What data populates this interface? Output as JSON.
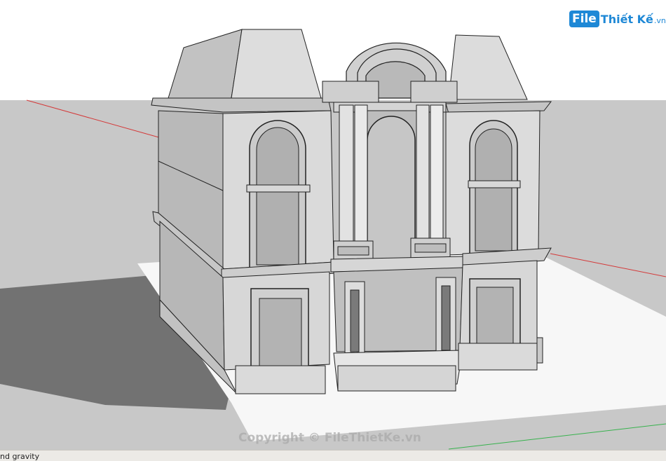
{
  "app": {
    "status_text": "nd gravity",
    "watermark": "Copyright © FileThietKe.vn"
  },
  "logo": {
    "mark": "File",
    "rest": "Thiết Kế",
    "tld": ".vn",
    "color": "#1e88d6"
  },
  "scene": {
    "sky_color": "#ffffff",
    "ground_color": "#c7c7c7",
    "shadow_color": "#707070",
    "red_axis_color": "#d43a3a",
    "green_axis_color": "#37b24d",
    "wall_light": "#dedede",
    "wall_mid": "#cfcfcf",
    "wall_dark": "#b5b5b5",
    "roof_color": "#d2d2d2",
    "plinth_color": "#d9d9d9"
  }
}
